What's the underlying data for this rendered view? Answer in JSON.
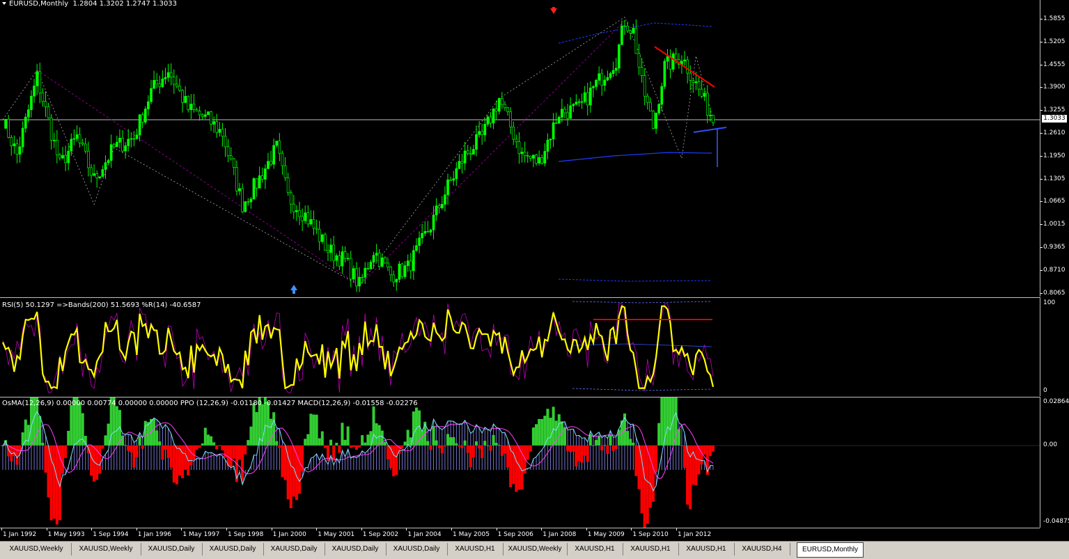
{
  "main": {
    "symbol_title": "EURUSD,Monthly",
    "ohlc": "1.2804 1.3202 1.2747 1.3033",
    "price_scale": [
      "1.5855",
      "1.5205",
      "1.4555",
      "1.3900",
      "1.3255",
      "1.2610",
      "1.1950",
      "1.1305",
      "1.0665",
      "1.0015",
      "0.9365",
      "0.8710",
      "0.8065"
    ],
    "current_price": "1.3033"
  },
  "rsi": {
    "label": "RSI(5) 50.1297  =>Bands(200) 51.5693  %R(14) -40.6587",
    "scale": [
      "100",
      "0"
    ]
  },
  "macd": {
    "label": "OsMA(12,26,9) 0.00000 0.00774 0.00000 0.00000  PPO (12,26,9) -0.01180 -0.01427  MACD(12,26,9) -0.01558 -0.02276",
    "scale": [
      "0.02864",
      "0.00",
      "-0.04875"
    ]
  },
  "time_axis": [
    "1 Jan 1992",
    "1 May 1993",
    "1 Sep 1994",
    "1 Jan 1996",
    "1 May 1997",
    "1 Sep 1998",
    "1 Jan 2000",
    "1 May 2001",
    "1 Sep 2002",
    "1 Jan 2004",
    "1 May 2005",
    "1 Sep 2006",
    "1 Jan 2008",
    "1 May 2009",
    "1 Sep 2010",
    "1 Jan 2012"
  ],
  "tabs": [
    "XAUUSD,Weekly",
    "XAUUSD,Weekly",
    "XAUUSD,Daily",
    "XAUUSD,Daily",
    "XAUUSD,Daily",
    "XAUUSD,Daily",
    "XAUUSD,Daily",
    "XAUUSD,H1",
    "XAUUSD,Weekly",
    "XAUUSD,H1",
    "XAUUSD,H1",
    "XAUUSD,H1",
    "XAUUSD,H4",
    "EURUSD,Monthly"
  ],
  "active_tab": "EURUSD,Monthly",
  "colors": {
    "up_candle": "#00ff00",
    "trend_red": "#ff0000",
    "band_blue": "#1e3cff",
    "rsi_yellow": "#ffff00",
    "pct_r": "#c000c0",
    "hist_green": "#32cd32",
    "hist_red": "#ff0000",
    "macd_cyan": "#80e0ff",
    "signal_magenta": "#ff40ff"
  }
}
